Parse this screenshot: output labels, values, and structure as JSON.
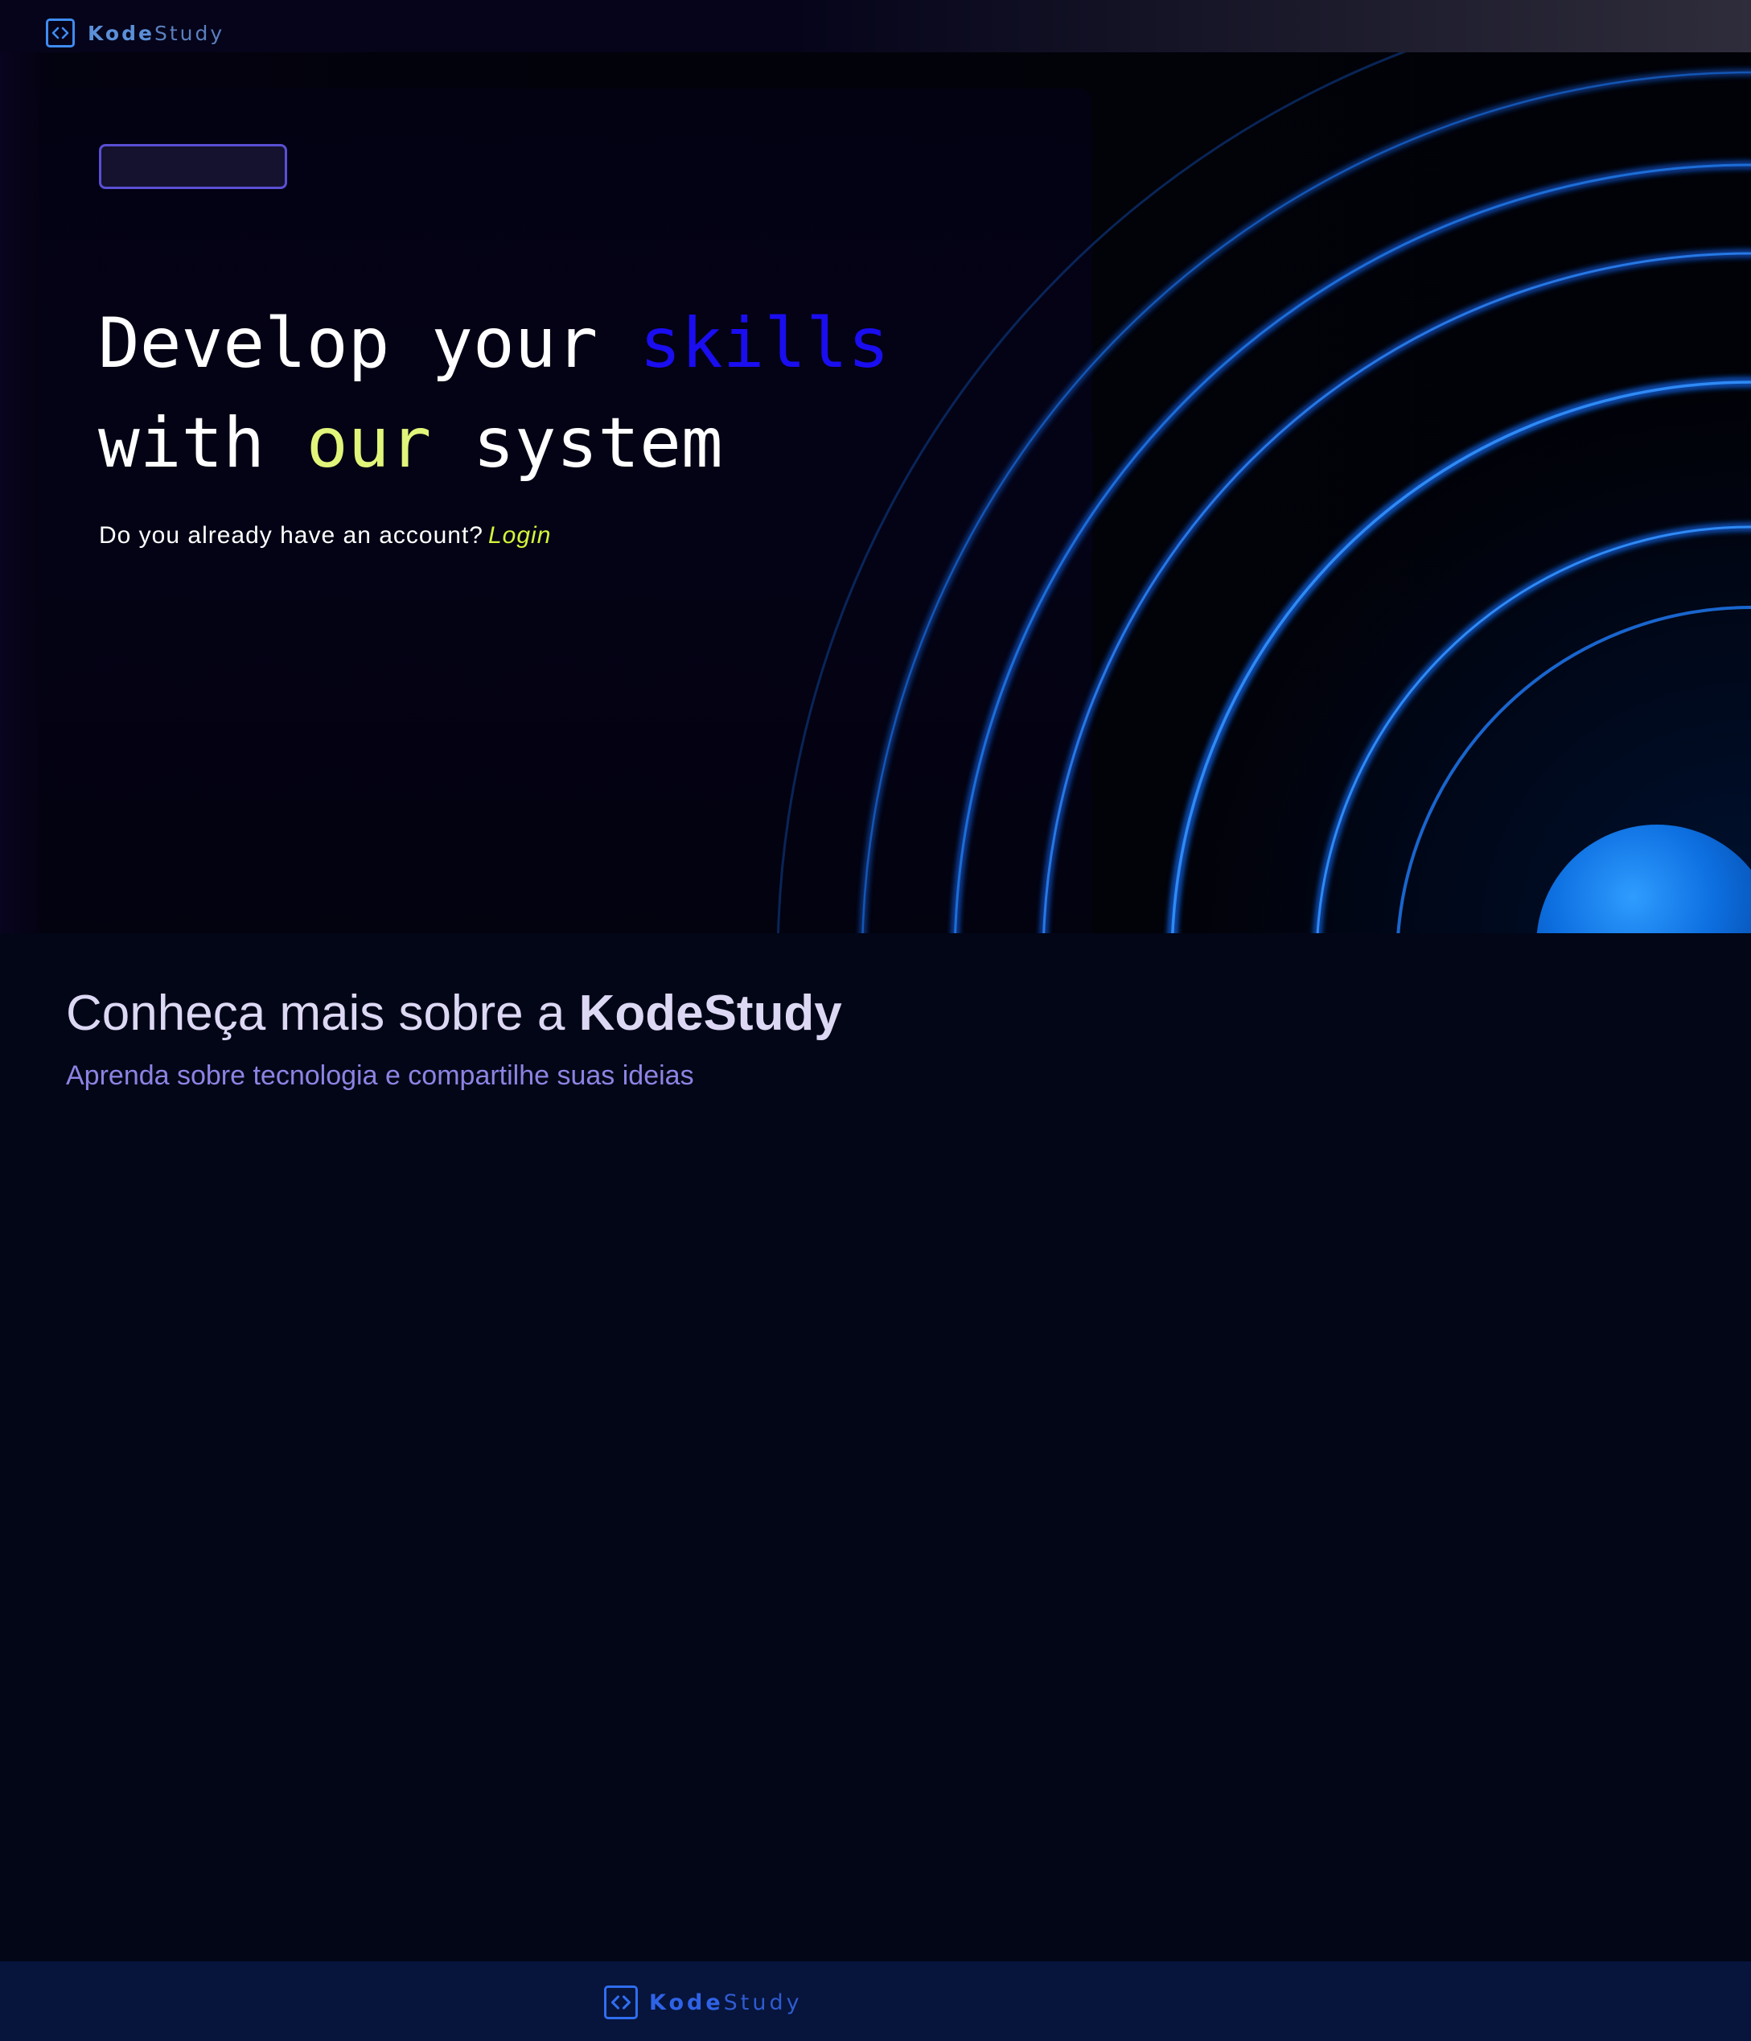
{
  "brand": {
    "name_part1": "Kode",
    "name_part2": "Study"
  },
  "nav": {
    "logo_icon": "code-brackets-icon"
  },
  "hero": {
    "tag_label": "",
    "headline_line1_a": "Develop your ",
    "headline_line1_b": "skills",
    "headline_line2_a": "with ",
    "headline_line2_b": "our",
    "headline_line2_c": " system",
    "account_question": "Do you already have an account?",
    "login_label": "Login"
  },
  "about": {
    "title_prefix": "Conheça mais sobre a ",
    "title_brand": "KodeStudy",
    "subtitle": "Aprenda sobre tecnologia e compartilhe suas ideias"
  },
  "footer": {
    "logo_icon": "code-brackets-icon"
  },
  "colors": {
    "headline_accent_blue": "#1a0df0",
    "headline_accent_yellow": "#e1f57a",
    "login_link": "#d4f53a",
    "about_title": "#dcd8f4",
    "about_subtitle": "#8d83e3",
    "footer_background": "#07143b",
    "page_background": "#020617"
  }
}
